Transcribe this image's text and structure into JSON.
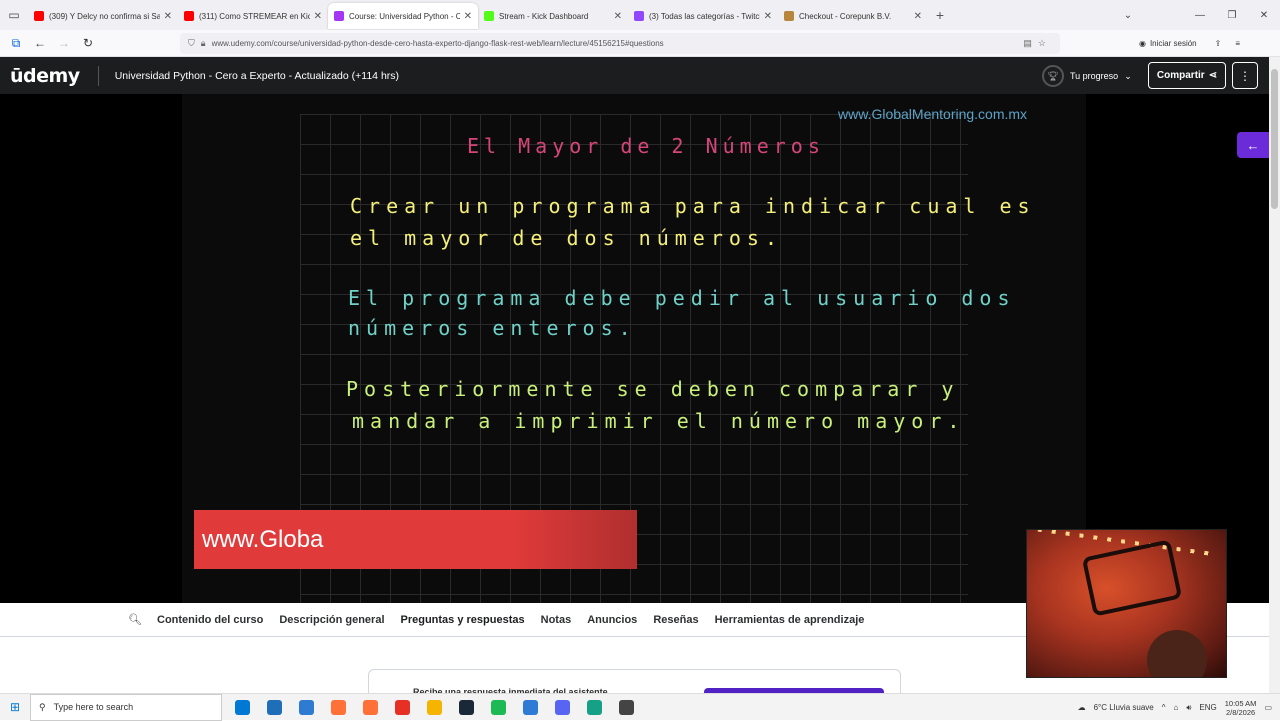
{
  "browser": {
    "tabs": [
      {
        "label": "(309) Y Delcy no confirma si Sa",
        "color": "#ff0000",
        "active": false
      },
      {
        "label": "(311) Como STREMEAR en Kick",
        "color": "#ff0000",
        "active": false
      },
      {
        "label": "Course: Universidad Python - C",
        "color": "#a435f0",
        "active": true
      },
      {
        "label": "Stream - Kick Dashboard",
        "color": "#53fc18",
        "active": false
      },
      {
        "label": "(3) Todas las categorías - Twitch",
        "color": "#9146ff",
        "active": false
      },
      {
        "label": "Checkout - Corepunk B.V.",
        "color": "#b8863b",
        "active": false
      }
    ],
    "url": "www.udemy.com/course/universidad-python-desde-cero-hasta-experto-django-flask-rest-web/learn/lecture/45156215#questions",
    "signin_label": "Iniciar sesión"
  },
  "header": {
    "logo": "ūdemy",
    "course_title": "Universidad Python - Cero a Experto - Actualizado (+114 hrs)",
    "progress_label": "Tu progreso",
    "share_label": "Compartir",
    "more_label": "⋮"
  },
  "video": {
    "watermark": "www.GlobalMentoring.com.mx",
    "title": "El Mayor de 2 Números",
    "lines_yellow": [
      "Crear un programa para indicar cual es",
      "el mayor de dos números."
    ],
    "lines_cyan": [
      "El programa debe pedir al usuario dos",
      "números enteros."
    ],
    "lines_green": [
      "Posteriormente se deben comparar y",
      "mandar a imprimir el número mayor."
    ],
    "banner_text": "www.Globa"
  },
  "course_tabs": [
    {
      "label": "Contenido del curso",
      "active": false
    },
    {
      "label": "Descripción general",
      "active": false
    },
    {
      "label": "Preguntas y respuestas",
      "active": true
    },
    {
      "label": "Notas",
      "active": false
    },
    {
      "label": "Anuncios",
      "active": false
    },
    {
      "label": "Reseñas",
      "active": false
    },
    {
      "label": "Herramientas de aprendizaje",
      "active": false
    }
  ],
  "ai_card": {
    "text": "Recibe una respuesta inmediata del asistente"
  },
  "taskbar": {
    "search_placeholder": "Type here to search",
    "weather": "6°C  Lluvia suave",
    "lang": "ENG",
    "time": "10:05 AM",
    "date": "2/8/2026",
    "apps": [
      "#0078d4",
      "#1e6fb8",
      "#2f7bd1",
      "#ff7139",
      "#ff7139",
      "#e63025",
      "#f4b400",
      "#1b2838",
      "#1db954",
      "#2e7bd6",
      "#5865f2",
      "#16a085",
      "#444444"
    ]
  }
}
